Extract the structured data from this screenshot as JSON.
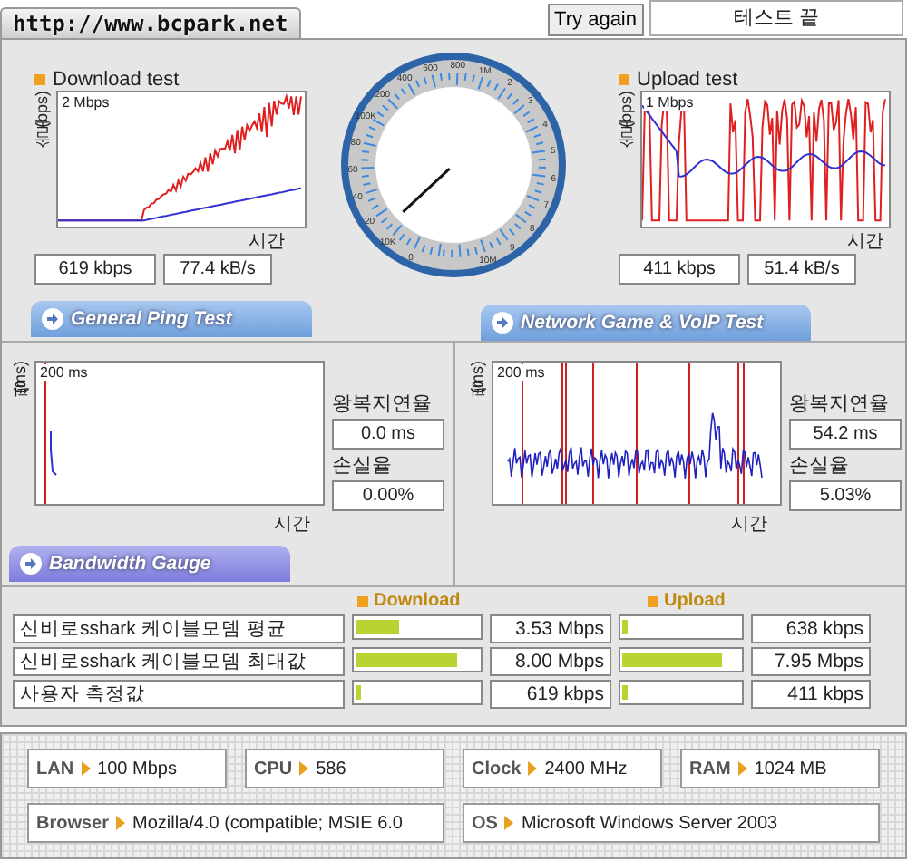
{
  "site_tab": "http://www.bcpark.net",
  "try_again": "Try again",
  "status": "테스트 끝",
  "download": {
    "title": "Download test",
    "y_label": "속도(bps)",
    "scale": "2 Mbps",
    "x_label": "시간",
    "readings": [
      "619 kbps",
      "77.4 kB/s"
    ]
  },
  "gauge": {
    "labels": [
      "0",
      "10K",
      "20",
      "40",
      "60",
      "80",
      "100K",
      "200",
      "400",
      "600",
      "800",
      "1M",
      "2",
      "3",
      "4",
      "5",
      "6",
      "7",
      "8",
      "9",
      "10M"
    ]
  },
  "upload": {
    "title": "Upload test",
    "y_label": "속도(bps)",
    "scale": "1 Mbps",
    "x_label": "시간",
    "readings": [
      "411 kbps",
      "51.4 kB/s"
    ]
  },
  "ping_tab": "General Ping Test",
  "voip_tab": "Network Game & VoIP Test",
  "ping_panels": [
    {
      "y_label": "핑(ms)",
      "scale": "200 ms",
      "x_label": "시간",
      "rtt_label": "왕복지연율",
      "rtt": "0.0 ms",
      "loss_label": "손실율",
      "loss": "0.00%"
    },
    {
      "y_label": "핑(ms)",
      "scale": "200 ms",
      "x_label": "시간",
      "rtt_label": "왕복지연율",
      "rtt": "54.2 ms",
      "loss_label": "손실율",
      "loss": "5.03%"
    }
  ],
  "bandwidth_tab": "Bandwidth Gauge",
  "bandwidth": {
    "download_title": "Download",
    "upload_title": "Upload",
    "rows": [
      {
        "name": "신비로sshark 케이블모뎀 평균",
        "download": {
          "level": 0.35,
          "reading": "3.53 Mbps"
        },
        "upload": {
          "level": 0.04,
          "reading": "638 kbps"
        }
      },
      {
        "name": "신비로sshark 케이블모뎀 최대값",
        "download": {
          "level": 0.83,
          "reading": "8.00 Mbps"
        },
        "upload": {
          "level": 0.85,
          "reading": "7.95 Mbps"
        }
      },
      {
        "name": "사용자 측정값",
        "download": {
          "level": 0.05,
          "reading": "619 kbps"
        },
        "upload": {
          "level": 0.04,
          "reading": "411 kbps"
        }
      }
    ]
  },
  "system": [
    {
      "label": "LAN",
      "value": "100 Mbps"
    },
    {
      "label": "CPU",
      "value": "586"
    },
    {
      "label": "Clock",
      "value": "2400 MHz"
    },
    {
      "label": "RAM",
      "value": "1024 MB"
    },
    {
      "label": "Browser",
      "value": "Mozilla/4.0 (compatible; MSIE 6.0"
    },
    {
      "label": "OS",
      "value": "Microsoft Windows Server 2003"
    }
  ]
}
